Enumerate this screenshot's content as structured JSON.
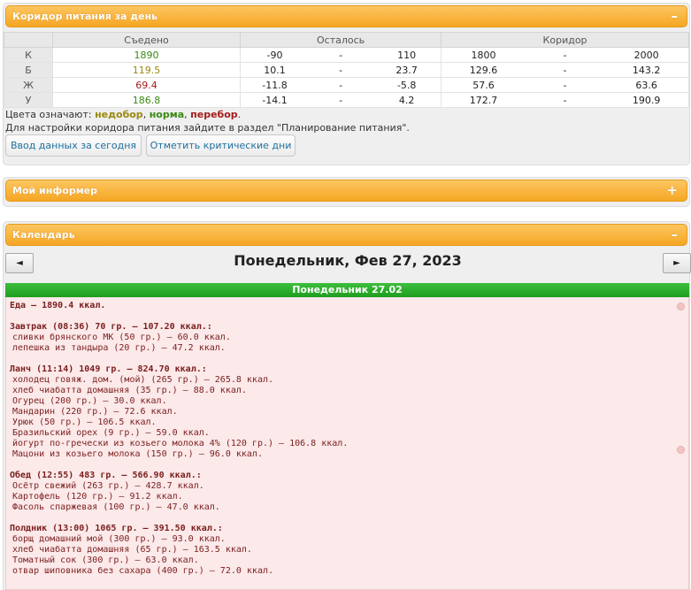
{
  "corridor_panel": {
    "title": "Коридор питания за день",
    "toggle": "–",
    "headers": [
      "Съедено",
      "Осталось",
      "Коридор"
    ],
    "rows": [
      {
        "label": "К",
        "eaten": "1890",
        "eaten_class": "good",
        "left_lo": "-90",
        "left_hi": "110",
        "cor_lo": "1800",
        "cor_hi": "2000"
      },
      {
        "label": "Б",
        "eaten": "119.5",
        "eaten_class": "under",
        "left_lo": "10.1",
        "left_hi": "23.7",
        "cor_lo": "129.6",
        "cor_hi": "143.2"
      },
      {
        "label": "Ж",
        "eaten": "69.4",
        "eaten_class": "over",
        "left_lo": "-11.8",
        "left_hi": "-5.8",
        "cor_lo": "57.6",
        "cor_hi": "63.6"
      },
      {
        "label": "У",
        "eaten": "186.8",
        "eaten_class": "good",
        "left_lo": "-14.1",
        "left_hi": "4.2",
        "cor_lo": "172.7",
        "cor_hi": "190.9"
      }
    ],
    "dash": "-",
    "legend_prefix": "Цвета означают:",
    "legend_under": "недобор",
    "legend_norm": "норма",
    "legend_over": "перебор",
    "settings_text": "Для настройки коридора питания зайдите в раздел \"Планирование питания\".",
    "btn_today": "Ввод данных за сегодня",
    "btn_critical": "Отметить критические дни"
  },
  "informer_panel": {
    "title": "Мой информер",
    "toggle": "+"
  },
  "calendar_panel": {
    "title": "Календарь",
    "toggle": "–",
    "prev": "◄",
    "next": "►",
    "date": "Понедельник, Фев 27, 2023",
    "day_header": "Понедельник 27.02",
    "lines": [
      {
        "text": "Еда — 1890.4 ккал.",
        "kind": "bold",
        "row": 0
      },
      {
        "text": "Завтрак (08:36) 70 гр. — 107.20 ккал.:",
        "kind": "bold",
        "row": 2
      },
      {
        "text": "сливки брянского МК (50 гр.) — 60.0 ккал.",
        "kind": "item",
        "row": 3
      },
      {
        "text": "лепешка из тандыра (20 гр.) — 47.2 ккал.",
        "kind": "item",
        "row": 4
      },
      {
        "text": "Ланч (11:14) 1049 гр. — 824.70 ккал.:",
        "kind": "bold",
        "row": 6
      },
      {
        "text": "холодец говяж. дом. (мой) (265 гр.) — 265.8 ккал.",
        "kind": "item",
        "row": 7
      },
      {
        "text": "хлеб чиабатта домашняя (35 гр.) — 88.0 ккал.",
        "kind": "item",
        "row": 8
      },
      {
        "text": "Огурец (200 гр.) — 30.0 ккал.",
        "kind": "item",
        "row": 9
      },
      {
        "text": "Мандарин (220 гр.) — 72.6 ккал.",
        "kind": "item",
        "row": 10
      },
      {
        "text": "Урюк (50 гр.) — 106.5 ккал.",
        "kind": "item",
        "row": 11
      },
      {
        "text": "Бразильский орех (9 гр.) — 59.0 ккал.",
        "kind": "item",
        "row": 12
      },
      {
        "text": "йогурт по-гречески из козьего молока 4% (120 гр.) — 106.8 ккал.",
        "kind": "item",
        "row": 13
      },
      {
        "text": "Мацони из козьего молока (150 гр.) — 96.0 ккал.",
        "kind": "item",
        "row": 14
      },
      {
        "text": "Обед (12:55) 483 гр. — 566.90 ккал.:",
        "kind": "bold",
        "row": 16
      },
      {
        "text": "Осётр свежий (263 гр.) — 428.7 ккал.",
        "kind": "item",
        "row": 17
      },
      {
        "text": "Картофель (120 гр.) — 91.2 ккал.",
        "kind": "item",
        "row": 18
      },
      {
        "text": "Фасоль спаржевая (100 гр.) — 47.0 ккал.",
        "kind": "item",
        "row": 19
      },
      {
        "text": "Полдник (13:00) 1065 гр. — 391.50 ккал.:",
        "kind": "bold",
        "row": 21
      },
      {
        "text": "борщ домашний мой (300 гр.) — 93.0 ккал.",
        "kind": "item",
        "row": 22
      },
      {
        "text": "хлеб чиабатта домашняя (65 гр.) — 163.5 ккал.",
        "kind": "item",
        "row": 23
      },
      {
        "text": "Томатный сок (300 гр.) — 63.0 ккал.",
        "kind": "item",
        "row": 24
      },
      {
        "text": "отвар шиповника без сахара (400 гр.) — 72.0 ккал.",
        "kind": "item",
        "row": 25
      }
    ]
  }
}
